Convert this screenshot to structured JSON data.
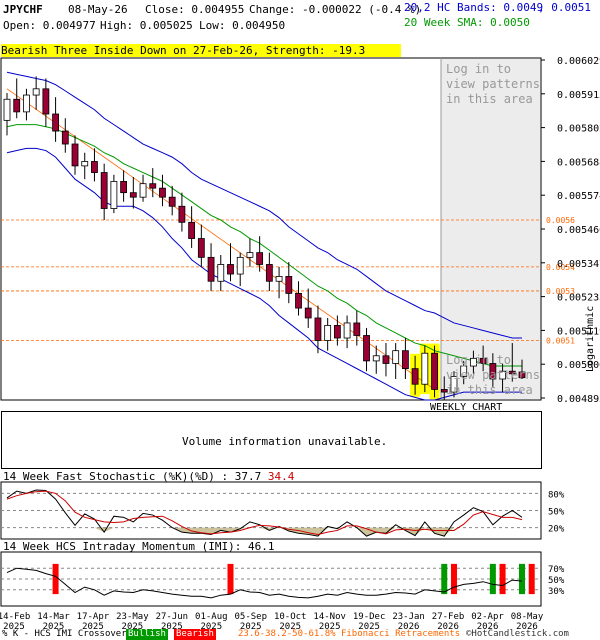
{
  "header": {
    "symbol": "JPYCHF",
    "date": "08-May-26",
    "close": "Close: 0.004955",
    "change": "Change: -0.000022 (-0.4 %)",
    "bands": "20,2 HC Bands: 0.0049",
    "bands_upper": ", 0.0051",
    "open": "Open: 0.004977",
    "high": "High: 0.005025",
    "low": "Low: 0.004950",
    "sma": "20 Week SMA: 0.0050"
  },
  "pattern_label": "Bearish Three Inside Down on 27-Feb-26, Strength: -19.3",
  "login_text": [
    "Log in to",
    "view patterns",
    "in this area"
  ],
  "weekly_chart": "WEEKLY CHART",
  "logarithmic": "Logarithmic",
  "volume_text": "Volume information unavailable.",
  "stoch_title": "14 Week Fast Stochastic (%K)(%D) : 37.7",
  "stoch_d": "34.4",
  "imi_title": "14 Week HCS Intraday Momentum (IMI): 46.1",
  "footer": {
    "left": "% K - HCS IMI Crossover:",
    "bullish": "Bullish",
    "bearish": "Bearish",
    "fib": "23.6-38.2-50-61.8% Fibonacci Retracements",
    "copyright": "©HotCandlestick.com"
  },
  "colors": {
    "bull": "#ffffff",
    "bear": "#990033",
    "upper_band": "#0000cc",
    "sma": "#009900",
    "fib": "#ff6600",
    "trend": "#ff6600",
    "badge_bull": "#009900",
    "badge_bear": "#ff0000"
  },
  "chart_data": {
    "type": "candlestick",
    "scale": "logarithmic",
    "ylim": [
      0.00487,
      0.00635
    ],
    "y_ticks": [
      "0.006029",
      "0.005915",
      "0.005802",
      "0.005688",
      "0.005574",
      "0.005460",
      "0.005347",
      "0.005233",
      "0.005119",
      "0.005006",
      "0.004892"
    ],
    "fib_levels": [
      "0.0056",
      "0.0054",
      "0.0053",
      "0.0051"
    ],
    "fib_values": [
      0.0056,
      0.0054,
      0.0053,
      0.0051
    ],
    "x_ticks": [
      "14-Feb\n2025",
      "14-Mar\n2025",
      "17-Apr\n2025",
      "23-May\n2025",
      "27-Jun\n2025",
      "01-Aug\n2025",
      "05-Sep\n2025",
      "10-Oct\n2025",
      "14-Nov\n2025",
      "19-Dec\n2025",
      "23-Jan\n2026",
      "27-Feb\n2026",
      "02-Apr\n2026",
      "08-May\n2026"
    ],
    "candles": [
      [
        0.00605,
        0.00618,
        0.00598,
        0.00615
      ],
      [
        0.00615,
        0.00625,
        0.00606,
        0.00609
      ],
      [
        0.00609,
        0.0062,
        0.00605,
        0.00617
      ],
      [
        0.00617,
        0.00626,
        0.0061,
        0.0062
      ],
      [
        0.0062,
        0.00625,
        0.00602,
        0.00608
      ],
      [
        0.00608,
        0.00616,
        0.00595,
        0.006
      ],
      [
        0.006,
        0.00606,
        0.0059,
        0.00594
      ],
      [
        0.00594,
        0.00598,
        0.0058,
        0.00584
      ],
      [
        0.00584,
        0.0059,
        0.00578,
        0.00586
      ],
      [
        0.00586,
        0.00592,
        0.00577,
        0.00581
      ],
      [
        0.00581,
        0.00585,
        0.0056,
        0.00565
      ],
      [
        0.00565,
        0.0058,
        0.00563,
        0.00577
      ],
      [
        0.00577,
        0.00582,
        0.00568,
        0.00572
      ],
      [
        0.00572,
        0.00579,
        0.00565,
        0.0057
      ],
      [
        0.0057,
        0.0058,
        0.00568,
        0.00576
      ],
      [
        0.00576,
        0.00583,
        0.0057,
        0.00574
      ],
      [
        0.00574,
        0.0058,
        0.00566,
        0.0057
      ],
      [
        0.0057,
        0.00575,
        0.00562,
        0.00566
      ],
      [
        0.00566,
        0.00572,
        0.00555,
        0.00559
      ],
      [
        0.00559,
        0.00566,
        0.00548,
        0.00552
      ],
      [
        0.00552,
        0.00558,
        0.0054,
        0.00544
      ],
      [
        0.00544,
        0.0055,
        0.0053,
        0.00534
      ],
      [
        0.00534,
        0.00545,
        0.0053,
        0.00541
      ],
      [
        0.00541,
        0.0055,
        0.00534,
        0.00537
      ],
      [
        0.00537,
        0.00546,
        0.00532,
        0.00544
      ],
      [
        0.00544,
        0.00552,
        0.0054,
        0.00546
      ],
      [
        0.00546,
        0.00553,
        0.00538,
        0.00541
      ],
      [
        0.00541,
        0.00546,
        0.0053,
        0.00534
      ],
      [
        0.00534,
        0.0054,
        0.00527,
        0.00536
      ],
      [
        0.00536,
        0.00542,
        0.00525,
        0.00529
      ],
      [
        0.00529,
        0.00534,
        0.0052,
        0.00523
      ],
      [
        0.00523,
        0.00531,
        0.00515,
        0.00519
      ],
      [
        0.00519,
        0.00524,
        0.00505,
        0.0051
      ],
      [
        0.0051,
        0.00519,
        0.00506,
        0.00516
      ],
      [
        0.00516,
        0.0052,
        0.00508,
        0.00511
      ],
      [
        0.00511,
        0.0052,
        0.00507,
        0.00517
      ],
      [
        0.00517,
        0.00522,
        0.00508,
        0.00512
      ],
      [
        0.00512,
        0.00515,
        0.00498,
        0.00502
      ],
      [
        0.00502,
        0.00508,
        0.00497,
        0.00504
      ],
      [
        0.00504,
        0.00509,
        0.00496,
        0.00501
      ],
      [
        0.00501,
        0.00509,
        0.00495,
        0.00506
      ],
      [
        0.00506,
        0.00511,
        0.00495,
        0.00499
      ],
      [
        0.00499,
        0.00504,
        0.00489,
        0.00493
      ],
      [
        0.00493,
        0.00508,
        0.0049,
        0.00505
      ],
      [
        0.00505,
        0.00508,
        0.00488,
        0.00491
      ],
      [
        0.00491,
        0.00496,
        0.00487,
        0.0049
      ],
      [
        0.0049,
        0.00498,
        0.00488,
        0.00496
      ],
      [
        0.00496,
        0.00502,
        0.00493,
        0.005
      ],
      [
        0.005,
        0.00506,
        0.00497,
        0.00503
      ],
      [
        0.00503,
        0.00508,
        0.00498,
        0.00501
      ],
      [
        0.00501,
        0.00505,
        0.00492,
        0.00495
      ],
      [
        0.00495,
        0.00501,
        0.0049,
        0.00498
      ],
      [
        0.00498,
        0.00509,
        0.00494,
        0.00497
      ],
      [
        0.004977,
        0.005025,
        0.00495,
        0.004955
      ]
    ],
    "upper_band": [
      0.00628,
      0.00627,
      0.00626,
      0.00625,
      0.00624,
      0.00622,
      0.00619,
      0.00616,
      0.00613,
      0.0061,
      0.00606,
      0.00603,
      0.006,
      0.00597,
      0.00594,
      0.00592,
      0.0059,
      0.00588,
      0.00585,
      0.00581,
      0.00578,
      0.00576,
      0.00574,
      0.00572,
      0.0057,
      0.00568,
      0.00566,
      0.00564,
      0.00561,
      0.00557,
      0.00554,
      0.00551,
      0.00548,
      0.00546,
      0.00543,
      0.00541,
      0.00539,
      0.00536,
      0.00533,
      0.0053,
      0.00528,
      0.00526,
      0.00524,
      0.00522,
      0.00521,
      0.00519,
      0.00517,
      0.00516,
      0.00515,
      0.00514,
      0.00513,
      0.00512,
      0.00511,
      0.00511
    ],
    "sma": [
      0.00602,
      0.00603,
      0.00603,
      0.00603,
      0.00602,
      0.00601,
      0.00599,
      0.00597,
      0.00595,
      0.00593,
      0.0059,
      0.00588,
      0.00585,
      0.00583,
      0.00581,
      0.00579,
      0.00577,
      0.00574,
      0.00571,
      0.00568,
      0.00565,
      0.00562,
      0.0056,
      0.00557,
      0.00555,
      0.00552,
      0.0055,
      0.00547,
      0.00544,
      0.00541,
      0.00538,
      0.00535,
      0.00532,
      0.0053,
      0.00527,
      0.00525,
      0.00522,
      0.0052,
      0.00517,
      0.00515,
      0.00513,
      0.00511,
      0.00509,
      0.00508,
      0.00506,
      0.00505,
      0.00504,
      0.00503,
      0.00502,
      0.00501,
      0.005,
      0.005,
      0.005,
      0.005
    ],
    "lower_band": [
      0.0059,
      0.00591,
      0.00592,
      0.00592,
      0.00591,
      0.00588,
      0.00583,
      0.00578,
      0.00575,
      0.00572,
      0.00568,
      0.00566,
      0.00566,
      0.00566,
      0.00564,
      0.00561,
      0.00557,
      0.00552,
      0.00548,
      0.00543,
      0.0054,
      0.00537,
      0.00535,
      0.00533,
      0.00531,
      0.00529,
      0.00527,
      0.00524,
      0.0052,
      0.00517,
      0.00514,
      0.00511,
      0.00507,
      0.00505,
      0.00503,
      0.00501,
      0.00499,
      0.00497,
      0.00495,
      0.00493,
      0.00491,
      0.00489,
      0.00488,
      0.00487,
      0.00487,
      0.00488,
      0.00489,
      0.0049,
      0.0049,
      0.0049,
      0.0049,
      0.0049,
      0.0049,
      0.0049
    ],
    "highlight_candles": [
      42,
      43,
      44
    ],
    "stochastic": {
      "ylim": [
        0,
        100
      ],
      "ticks": [
        "80%",
        "50%",
        "20%"
      ],
      "tick_values": [
        80,
        50,
        20
      ],
      "k": [
        72,
        84,
        80,
        86,
        85,
        70,
        46,
        24,
        44,
        35,
        12,
        40,
        38,
        30,
        45,
        42,
        33,
        20,
        12,
        10,
        10,
        8,
        15,
        12,
        18,
        30,
        25,
        15,
        22,
        14,
        10,
        8,
        5,
        22,
        18,
        30,
        20,
        5,
        12,
        10,
        25,
        15,
        6,
        30,
        10,
        5,
        30,
        42,
        55,
        48,
        25,
        40,
        50,
        38
      ],
      "d": [
        70,
        76,
        80,
        83,
        84,
        80,
        67,
        47,
        38,
        34,
        30,
        29,
        30,
        36,
        38,
        39,
        40,
        32,
        22,
        14,
        11,
        9,
        11,
        12,
        15,
        20,
        24,
        23,
        21,
        17,
        15,
        11,
        8,
        12,
        15,
        23,
        23,
        18,
        12,
        9,
        16,
        17,
        15,
        17,
        15,
        15,
        15,
        26,
        42,
        48,
        43,
        38,
        38,
        34
      ]
    },
    "imi": {
      "ylim": [
        0,
        100
      ],
      "ticks": [
        "70%",
        "50%",
        "30%"
      ],
      "tick_values": [
        70,
        50,
        30
      ],
      "values": [
        62,
        70,
        68,
        66,
        60,
        55,
        40,
        25,
        35,
        30,
        20,
        28,
        26,
        25,
        30,
        28,
        25,
        22,
        20,
        18,
        18,
        15,
        20,
        22,
        30,
        26,
        25,
        20,
        22,
        18,
        16,
        15,
        18,
        22,
        20,
        25,
        22,
        20,
        20,
        22,
        25,
        24,
        22,
        30,
        28,
        26,
        35,
        40,
        42,
        45,
        40,
        38,
        48,
        46
      ],
      "crossovers": [
        {
          "index": 5,
          "type": "bearish"
        },
        {
          "index": 23,
          "type": "bearish"
        },
        {
          "index": 45,
          "type": "bullish"
        },
        {
          "index": 46,
          "type": "bearish"
        },
        {
          "index": 50,
          "type": "bullish"
        },
        {
          "index": 51,
          "type": "bearish"
        },
        {
          "index": 53,
          "type": "bullish"
        },
        {
          "index": 54,
          "type": "bearish"
        }
      ]
    }
  }
}
